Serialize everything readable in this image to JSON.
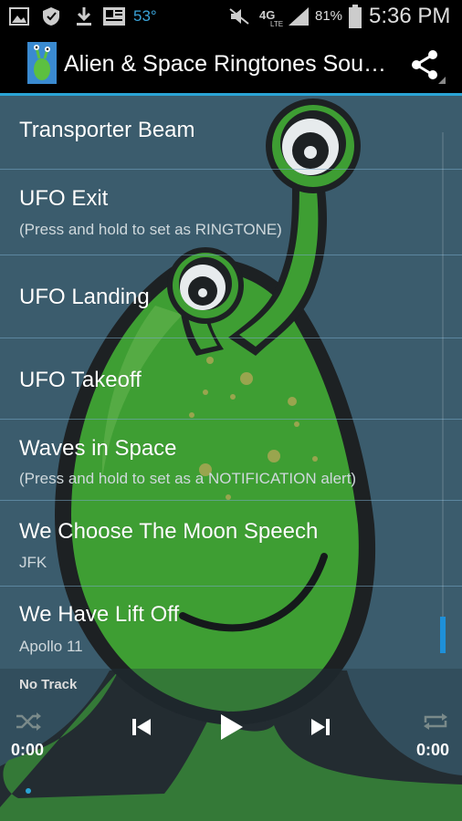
{
  "status_bar": {
    "temperature": "53°",
    "battery_percent": "81%",
    "time": "5:36 PM",
    "left_icons": [
      "gallery-icon",
      "shield-icon",
      "download-icon",
      "news-icon"
    ],
    "right_icons": [
      "mute-icon",
      "4g-lte-icon",
      "signal-icon",
      "battery-icon"
    ]
  },
  "action_bar": {
    "title": "Alien & Space Ringtones Sou…",
    "share_icon": "share-icon"
  },
  "list": [
    {
      "title": "Transporter Beam",
      "subtitle": ""
    },
    {
      "title": "UFO Exit",
      "subtitle": "(Press and hold to set as RINGTONE)"
    },
    {
      "title": "UFO Landing",
      "subtitle": ""
    },
    {
      "title": "UFO Takeoff",
      "subtitle": ""
    },
    {
      "title": "Waves in Space",
      "subtitle": "(Press and hold to set as a NOTIFICATION alert)"
    },
    {
      "title": "We Choose The Moon Speech",
      "subtitle": "JFK"
    },
    {
      "title": "We Have Lift Off",
      "subtitle": "Apollo 11"
    }
  ],
  "player": {
    "track": "No Track",
    "elapsed": "0:00",
    "duration": "0:00",
    "progress": 0
  },
  "colors": {
    "accent": "#2aa5d6",
    "background": "#3c5d6e",
    "alien_green": "#3fa82c"
  }
}
